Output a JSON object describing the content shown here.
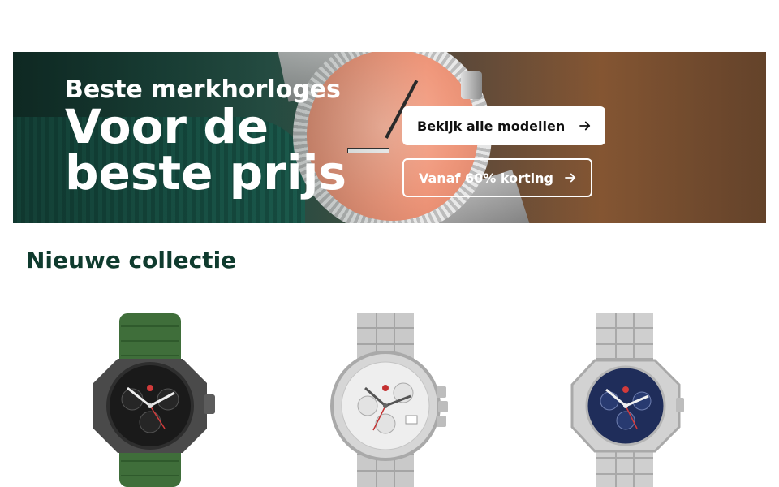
{
  "hero": {
    "eyebrow": "Beste merkhorloges",
    "title_line1": "Voor de",
    "title_line2": "beste prijs",
    "primary_button": "Bekijk alle modellen",
    "secondary_button": "Vanaf 60% korting"
  },
  "section": {
    "title": "Nieuwe collectie"
  },
  "products": [
    {
      "image": "watch-green-strap-black-dial"
    },
    {
      "image": "watch-steel-silver-dial"
    },
    {
      "image": "watch-steel-blue-dial"
    }
  ],
  "colors": {
    "section_title": "#0f3b2e",
    "button_bg": "#ffffff"
  }
}
